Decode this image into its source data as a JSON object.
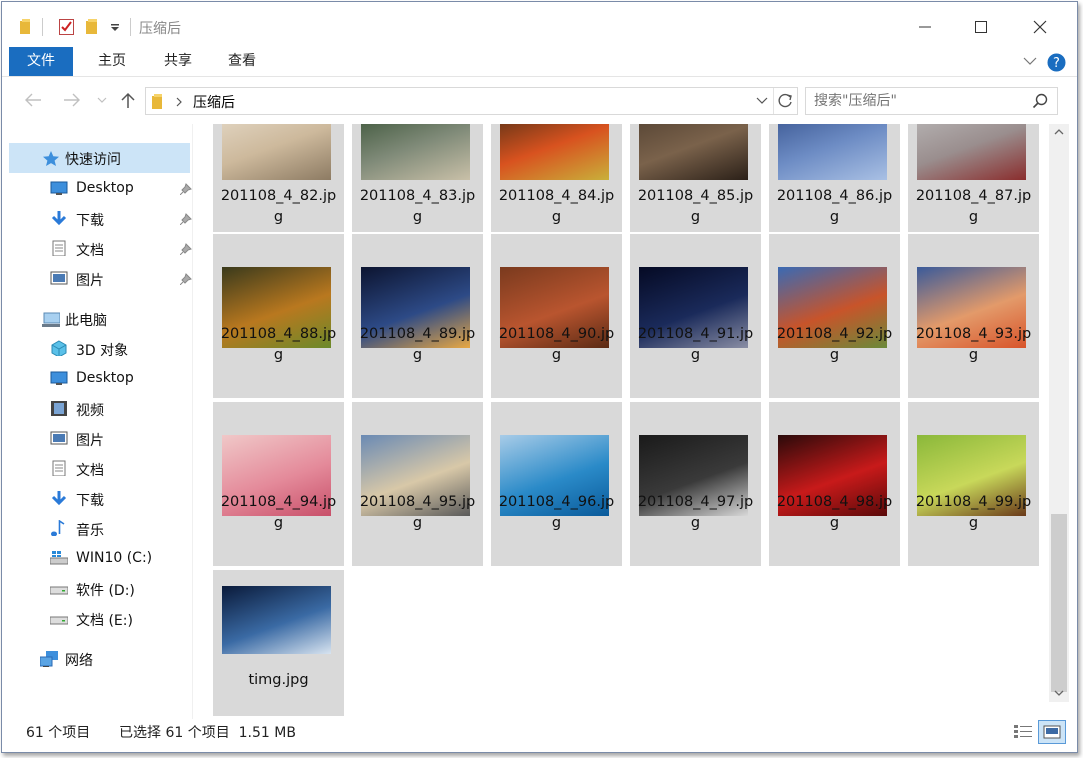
{
  "window": {
    "title": "压缩后",
    "quick_access_icons": [
      "folder-icon",
      "properties-checkbox-icon",
      "new-folder-icon",
      "customize-dropdown-icon"
    ],
    "controls": [
      "minimize-icon",
      "maximize-icon",
      "close-icon"
    ]
  },
  "ribbon": {
    "tabs": [
      {
        "label": "文件",
        "active": true
      },
      {
        "label": "主页"
      },
      {
        "label": "共享"
      },
      {
        "label": "查看"
      }
    ],
    "accent": "#1a6dc0"
  },
  "address": {
    "path": [
      "压缩后"
    ],
    "search_placeholder": "搜索\"压缩后\""
  },
  "sidebar": {
    "quick_access": "快速访问",
    "quick_items": [
      {
        "label": "Desktop",
        "icon": "desktop-icon",
        "pinned": true
      },
      {
        "label": "下载",
        "icon": "download-arrow-icon",
        "pinned": true
      },
      {
        "label": "文档",
        "icon": "document-icon",
        "pinned": true
      },
      {
        "label": "图片",
        "icon": "pictures-icon",
        "pinned": true
      }
    ],
    "this_pc": "此电脑",
    "pc_items": [
      {
        "label": "3D 对象",
        "icon": "3d-objects-icon"
      },
      {
        "label": "Desktop",
        "icon": "desktop-icon"
      },
      {
        "label": "视频",
        "icon": "video-icon"
      },
      {
        "label": "图片",
        "icon": "pictures-icon"
      },
      {
        "label": "文档",
        "icon": "document-icon"
      },
      {
        "label": "下载",
        "icon": "download-arrow-icon"
      },
      {
        "label": "音乐",
        "icon": "music-note-icon"
      },
      {
        "label": "WIN10 (C:)",
        "icon": "windows-drive-icon"
      },
      {
        "label": "软件 (D:)",
        "icon": "drive-icon"
      },
      {
        "label": "文档 (E:)",
        "icon": "drive-icon"
      }
    ],
    "network": "网络"
  },
  "files": [
    {
      "name": "201108_4_82.jpg",
      "palette": [
        "#e9dfcf",
        "#cdb99c",
        "#8d7b63"
      ]
    },
    {
      "name": "201108_4_83.jpg",
      "palette": [
        "#2e4a2c",
        "#7f8a78",
        "#c9c0a8"
      ]
    },
    {
      "name": "201108_4_84.jpg",
      "palette": [
        "#3d2a14",
        "#d8521f",
        "#c9b03a"
      ]
    },
    {
      "name": "201108_4_85.jpg",
      "palette": [
        "#4a3a2c",
        "#7a624b",
        "#2b2018"
      ]
    },
    {
      "name": "201108_4_86.jpg",
      "palette": [
        "#2e4a86",
        "#6d8cc4",
        "#a9c0e4"
      ]
    },
    {
      "name": "201108_4_87.jpg",
      "palette": [
        "#bfbfbf",
        "#9a8e8e",
        "#8a2d2d"
      ]
    },
    {
      "name": "201108_4_88.jpg",
      "palette": [
        "#3a3a1c",
        "#b9781f",
        "#6b8a2a"
      ]
    },
    {
      "name": "201108_4_89.jpg",
      "palette": [
        "#0c1430",
        "#2d4a86",
        "#e8a844"
      ]
    },
    {
      "name": "201108_4_90.jpg",
      "palette": [
        "#7a3a1e",
        "#b9552f",
        "#5a2a14"
      ]
    },
    {
      "name": "201108_4_91.jpg",
      "palette": [
        "#050a24",
        "#1a2a5a",
        "#8a8ea4"
      ]
    },
    {
      "name": "201108_4_92.jpg",
      "palette": [
        "#3a6ab4",
        "#c8542a",
        "#6a8a3a"
      ]
    },
    {
      "name": "201108_4_93.jpg",
      "palette": [
        "#3a5a9a",
        "#e39a6a",
        "#d8542a"
      ]
    },
    {
      "name": "201108_4_94.jpg",
      "palette": [
        "#f0c8c8",
        "#e48a9a",
        "#c8506a"
      ]
    },
    {
      "name": "201108_4_95.jpg",
      "palette": [
        "#6a8ab4",
        "#d8c8a8",
        "#5a5a5a"
      ]
    },
    {
      "name": "201108_4_96.jpg",
      "palette": [
        "#a8cce8",
        "#2a8ac8",
        "#0a5a9a"
      ]
    },
    {
      "name": "201108_4_97.jpg",
      "palette": [
        "#1a1a1a",
        "#3a3a3a",
        "#d8d8d8"
      ]
    },
    {
      "name": "201108_4_98.jpg",
      "palette": [
        "#2a0a0a",
        "#c81a1a",
        "#5a0a0a"
      ]
    },
    {
      "name": "201108_4_99.jpg",
      "palette": [
        "#8ab83a",
        "#c8d85a",
        "#6a3a1a"
      ]
    },
    {
      "name": "timg.jpg",
      "palette": [
        "#0a1a3a",
        "#3a6aa4",
        "#d8e4f0"
      ]
    }
  ],
  "status": {
    "count": "61 个项目",
    "selection": "已选择 61 个项目  1.51 MB"
  }
}
